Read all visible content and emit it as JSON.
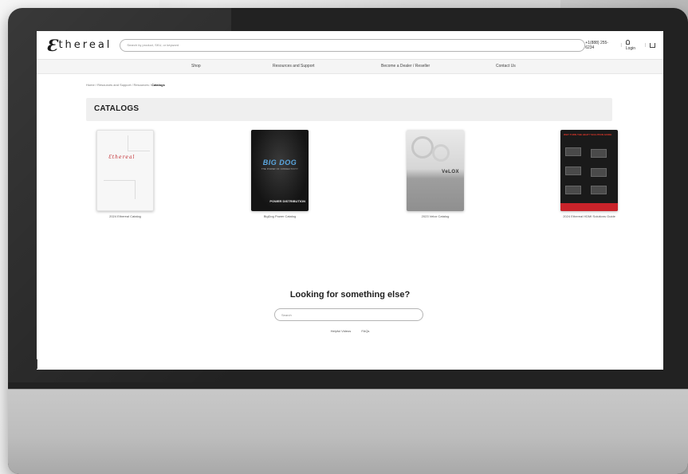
{
  "header": {
    "logo_mark": "Ɛ",
    "logo_text": "thereal",
    "search_placeholder": "Search by product, SKU, or keyword",
    "phone": "+1(888) 255-6234",
    "login_label": "Login"
  },
  "nav": {
    "items": [
      {
        "label": "Shop"
      },
      {
        "label": "Resources and Support"
      },
      {
        "label": "Become a Dealer / Reseller"
      },
      {
        "label": "Contact Us"
      }
    ]
  },
  "breadcrumb": {
    "home": "Home",
    "resources_support": "Resources and Support",
    "resources": "Resources",
    "current": "Catalogs",
    "separator": "/"
  },
  "page": {
    "title": "CATALOGS"
  },
  "catalogs": [
    {
      "label": "2024 Ethereal Catalog",
      "cover_word": "Ɛthereal"
    },
    {
      "label": "BigDog Power Catalog",
      "cover_word": "BIG DOG",
      "cover_tagline": "THE POWER OF CONNECTIVITY",
      "cover_sub": "POWER DISTRIBUTION"
    },
    {
      "label": "2023 Velox Catalog",
      "cover_word": "VeLOX"
    },
    {
      "label": "2024 Ethereal HDMI Solutions Guide",
      "cover_title": "WHY TURN THE HEAT? SOLUTION GUIDE"
    }
  ],
  "footer_search": {
    "heading": "Looking for something else?",
    "placeholder": "Search",
    "links": [
      {
        "label": "Helpful Videos"
      },
      {
        "label": "FAQs"
      }
    ]
  },
  "colors": {
    "ethereal_red": "#c0282d",
    "bigdog_blue": "#5aa7e0",
    "hdmi_red": "#c9232a",
    "bezel": "#222222"
  }
}
